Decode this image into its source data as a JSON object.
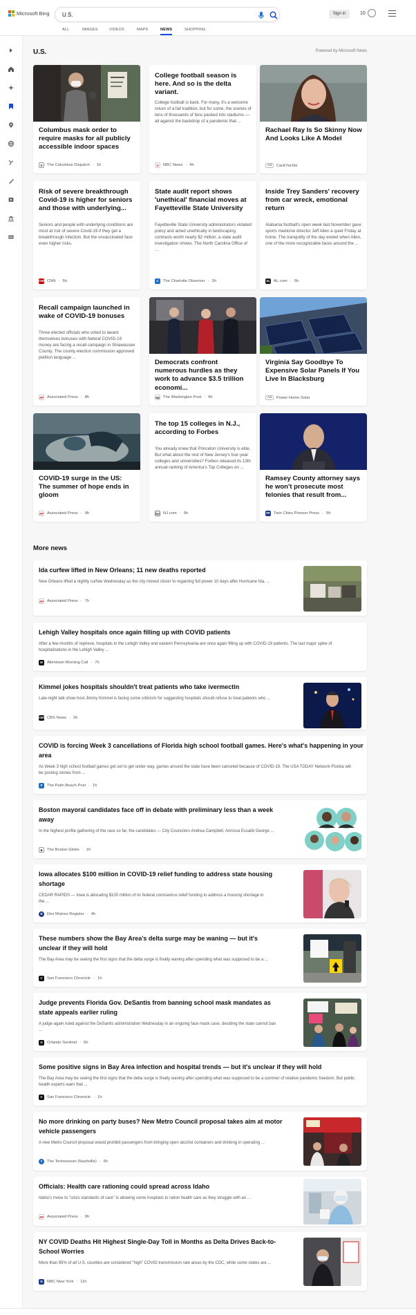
{
  "header": {
    "brand": "Microsoft Bing",
    "search_value": "U.S.",
    "sign_in": "Sign in",
    "rewards_count": "10"
  },
  "scopes": [
    "ALL",
    "IMAGES",
    "VIDEOS",
    "MAPS",
    "NEWS",
    "SHOPPING"
  ],
  "active_scope": "NEWS",
  "page_title": "U.S.",
  "powered_by": "Powered by Microsoft News",
  "cards": [
    {
      "title": "Columbus mask order to require masks for all publicly accessible indoor spaces",
      "source": "The Columbus Dispatch",
      "time": "1h",
      "image": "woman-mask-store"
    },
    {
      "title": "College football season is here. And so is the delta variant.",
      "snippet": "College football is back. For many, it's a welcome return of a fall tradition, but for some, the scenes of tens of thousands of fans packed into stadiums — all against the backdrop of a pandemic that ...",
      "source": "NBC News",
      "time": "4h"
    },
    {
      "title": "Rachael Ray Is So Skinny Now And Looks Like A Model",
      "source": "Car&Yachts",
      "ad": "Ad",
      "image": "woman-portrait"
    },
    {
      "title": "Risk of severe breakthrough Covid-19 is higher for seniors and those with underlying...",
      "snippet": "Seniors and people with underlying conditions are most at risk of severe Covid-19 if they get a breakthrough infection. But the unvaccinated face even higher risks.",
      "source": "CNN",
      "time": "5h"
    },
    {
      "title": "State audit report shows 'unethical' financial moves at Fayetteville State University",
      "snippet": "Fayetteville State University administrators violated policy and acted unethically in landscaping contracts worth nearly $2 million, a state audit investigation shows. The North Carolina Office of ...",
      "source": "The Charlotte Observer",
      "time": "3h"
    },
    {
      "title": "Inside Trey Sanders' recovery from car wreck, emotional return",
      "snippet": "Alabama football's open week last November gave sports medicine director Jeff Allen a quiet Friday at home. The tranquility of the day ended when Allen, one of the more recognizable faces around the ...",
      "source": "AL.com",
      "time": "5h"
    },
    {
      "title": "Recall campaign launched in wake of COVID-19 bonuses",
      "snippet": "Three elected officials who voted to award themselves bonuses with federal COVID-19 money are facing a recall campaign in Shiawassee County. The county election commission approved petition language ...",
      "source": "Associated Press",
      "time": "8h"
    },
    {
      "title": "Democrats confront numerous hurdles as they work to advance $3.5 trillion economi...",
      "source": "The Washington Post",
      "time": "9h",
      "image": "capitol-walk"
    },
    {
      "title": "Virginia Say Goodbye To Expensive Solar Panels If You Live In Blacksburg",
      "source": "Power Home Solar",
      "ad": "Ad",
      "image": "solar-roof"
    },
    {
      "title": "COVID-19 surge in the US: The summer of hope ends in gloom",
      "source": "Associated Press",
      "time": "9h",
      "image": "hospital-patient"
    },
    {
      "title": "The top 15 colleges in N.J., according to Forbes",
      "snippet": "You already knew that Princeton University is elite. But what about the rest of New Jersey's four-year colleges and universities? Forbes released its 13th annual ranking of America's Top Colleges on ...",
      "source": "NJ.com",
      "time": "9h"
    },
    {
      "title": "Ramsey County attorney says he won't prosecute most felonies that result from...",
      "source": "Twin Cities Pioneer Press",
      "time": "9h",
      "image": "man-podium"
    }
  ],
  "more_news_title": "More news",
  "more_news": [
    {
      "title": "Ida curfew lifted in New Orleans; 11 new deaths reported",
      "snippet": "New Orleans lifted a nightly curfew Wednesday as the city moved closer to regaining full power 10 days after Hurricane Ida, ...",
      "source": "Associated Press",
      "time": "7h",
      "image": "storm-debris"
    },
    {
      "title": "Lehigh Valley hospitals once again filling up with COVID patients",
      "snippet": "After a few months of reprieve, hospitals in the Lehigh Valley and eastern Pennsylvania are once again filling up with COVID-19 patients. The last major spike of hospitalizations in the Lehigh Valley ...",
      "source": "Allentown Morning Call",
      "time": "7h"
    },
    {
      "title": "Kimmel jokes hospitals shouldn't treat patients who take ivermectin",
      "snippet": "Late-night talk show host Jimmy Kimmel is facing some criticism for suggesting hospitals should refuse to treat patients who ...",
      "source": "CBS News",
      "time": "2h",
      "image": "talk-show-host"
    },
    {
      "title": "COVID is forcing Week 3 cancellations of Florida high school football games. Here's what's happening in your area",
      "snippet": "As Week 3 high school football games get set to get under way, games around the state have been canceled because of COVID-19. The USA TODAY Network-Florida will be posting stories from ...",
      "source": "The Palm Beach Post",
      "time": "1h"
    },
    {
      "title": "Boston mayoral candidates face off in debate with preliminary less than a week away",
      "snippet": "In the highest profile gathering of the race so far, the candidates — City Councilors Andrea Campbell, Annissa Essaibi George ...",
      "source": "The Boston Globe",
      "time": "1h",
      "image": "candidate-headshots"
    },
    {
      "title": "Iowa allocates $100 million in COVID-19 relief funding to address state housing shortage",
      "snippet": "CEDAR RAPIDS — Iowa is allocating $100 million of its federal coronavirus relief funding to address a housing shortage in the ...",
      "source": "Des Moines Register",
      "time": "4h",
      "image": "governor-speaking"
    },
    {
      "title": "These numbers show the Bay Area's delta surge may be waning — but it's unclear if they will hold",
      "snippet": "The Bay Area may be seeing the first signs that the delta surge is finally waning after upending what was supposed to be a ...",
      "source": "San Francisco Chronicle",
      "time": "1h",
      "image": "testing-site"
    },
    {
      "title": "Judge prevents Florida Gov. DeSantis from banning school mask mandates as state appeals earlier ruling",
      "snippet": "A judge again ruled against the DeSantis administration Wednesday in an ongoing face mask case, deciding the state cannot ban ...",
      "source": "Orlando Sentinel",
      "time": "6h",
      "image": "protest-signs"
    },
    {
      "title": "Some positive signs in Bay Area infection and hospital trends — but it's unclear if they will hold",
      "snippet": "The Bay Area may be seeing the first signs that the delta surge is finally waning after upending what was supposed to be a summer of relative pandemic freedom. But public health experts warn that ...",
      "source": "San Francisco Chronicle",
      "time": "1h"
    },
    {
      "title": "No more drinking on party buses? New Metro Council proposal takes aim at motor vehicle passengers",
      "snippet": "A new Metro Council proposal would prohibit passengers from bringing open alcohol containers and drinking in operating ...",
      "source": "The Tennessean (Nashville)",
      "time": "6h",
      "image": "party-bus"
    },
    {
      "title": "Officials: Health care rationing could spread across Idaho",
      "snippet": "Idaho's move to \"crisis standards of care\" is allowing some hospitals to ration health care as they struggle with an ...",
      "source": "Associated Press",
      "time": "9h",
      "image": "icu-nurse"
    },
    {
      "title": "NY COVID Deaths Hit Highest Single-Day Toll in Months as Delta Drives Back-to-School Worries",
      "snippet": "More than 95% of all U.S. counties are considered \"high\" COVID transmission rate areas by the CDC, while some states are ...",
      "source": "NBC New York",
      "time": "11h",
      "image": "street-mask-sign"
    }
  ]
}
